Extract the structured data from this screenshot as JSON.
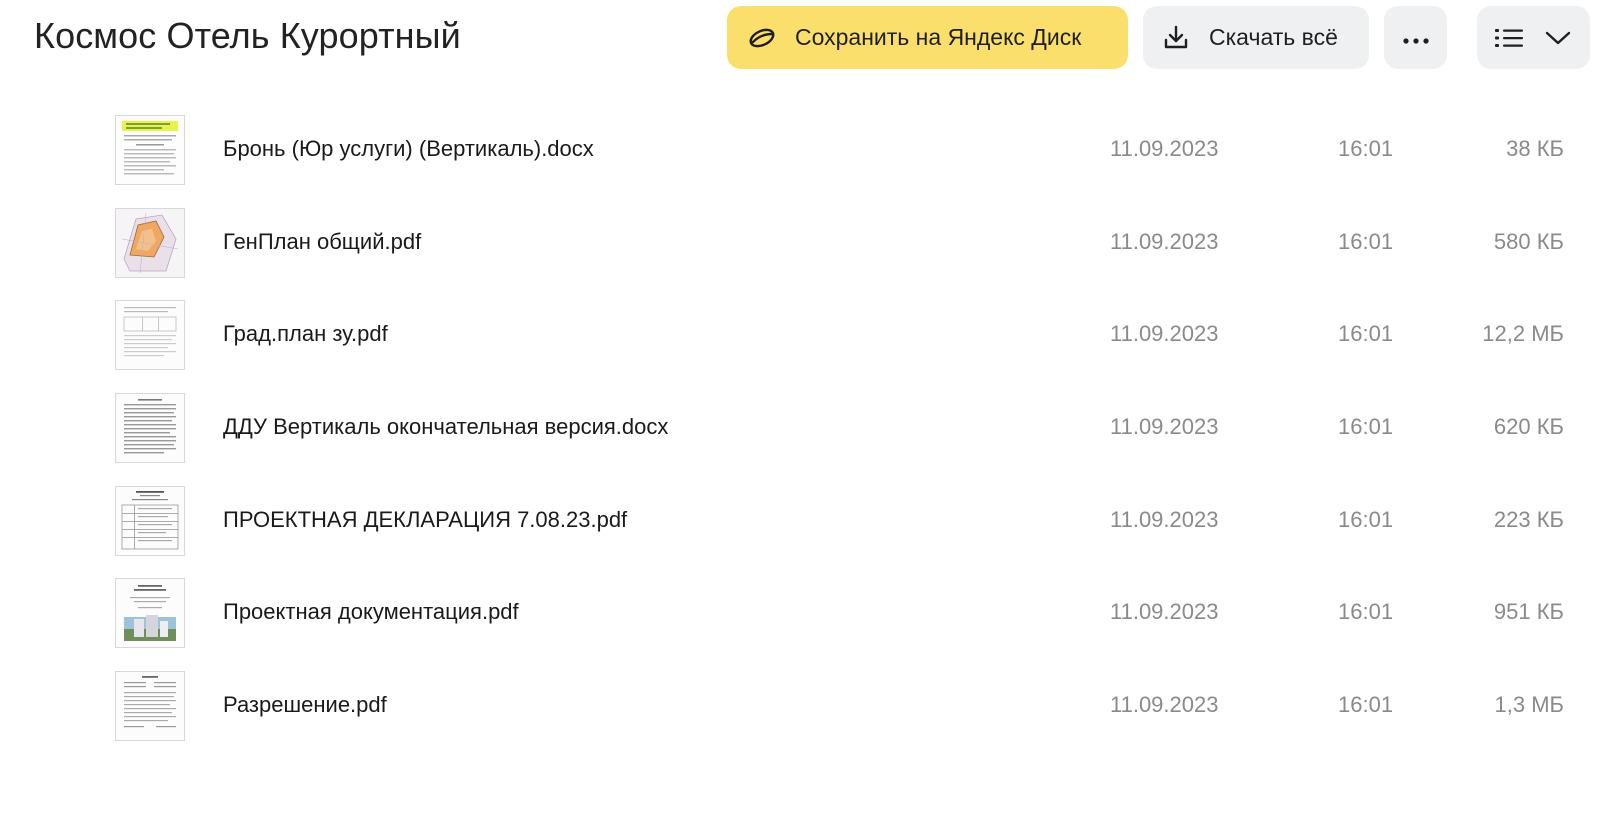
{
  "header": {
    "title": "Космос Отель Курортный",
    "save_label": "Сохранить на Яндекс Диск",
    "download_label": "Скачать всё",
    "more_icon": "ellipsis-icon",
    "view_icon": "list-view-icon",
    "view_chevron_icon": "chevron-down-icon"
  },
  "colors": {
    "save_button_bg": "#fbdf6d",
    "secondary_button_bg": "#eef0f2",
    "meta_text": "#8a8a8a"
  },
  "files": [
    {
      "name": "Бронь (Юр услуги) (Вертикаль).docx",
      "date": "11.09.2023",
      "time": "16:01",
      "size": "38 КБ"
    },
    {
      "name": "ГенПлан общий.pdf",
      "date": "11.09.2023",
      "time": "16:01",
      "size": "580 КБ"
    },
    {
      "name": "Град.план зу.pdf",
      "date": "11.09.2023",
      "time": "16:01",
      "size": "12,2 МБ"
    },
    {
      "name": "ДДУ Вертикаль окончательная версия.docx",
      "date": "11.09.2023",
      "time": "16:01",
      "size": "620 КБ"
    },
    {
      "name": "ПРОЕКТНАЯ ДЕКЛАРАЦИЯ 7.08.23.pdf",
      "date": "11.09.2023",
      "time": "16:01",
      "size": "223 КБ"
    },
    {
      "name": "Проектная документация.pdf",
      "date": "11.09.2023",
      "time": "16:01",
      "size": "951 КБ"
    },
    {
      "name": "Разрешение.pdf",
      "date": "11.09.2023",
      "time": "16:01",
      "size": "1,3 МБ"
    }
  ]
}
